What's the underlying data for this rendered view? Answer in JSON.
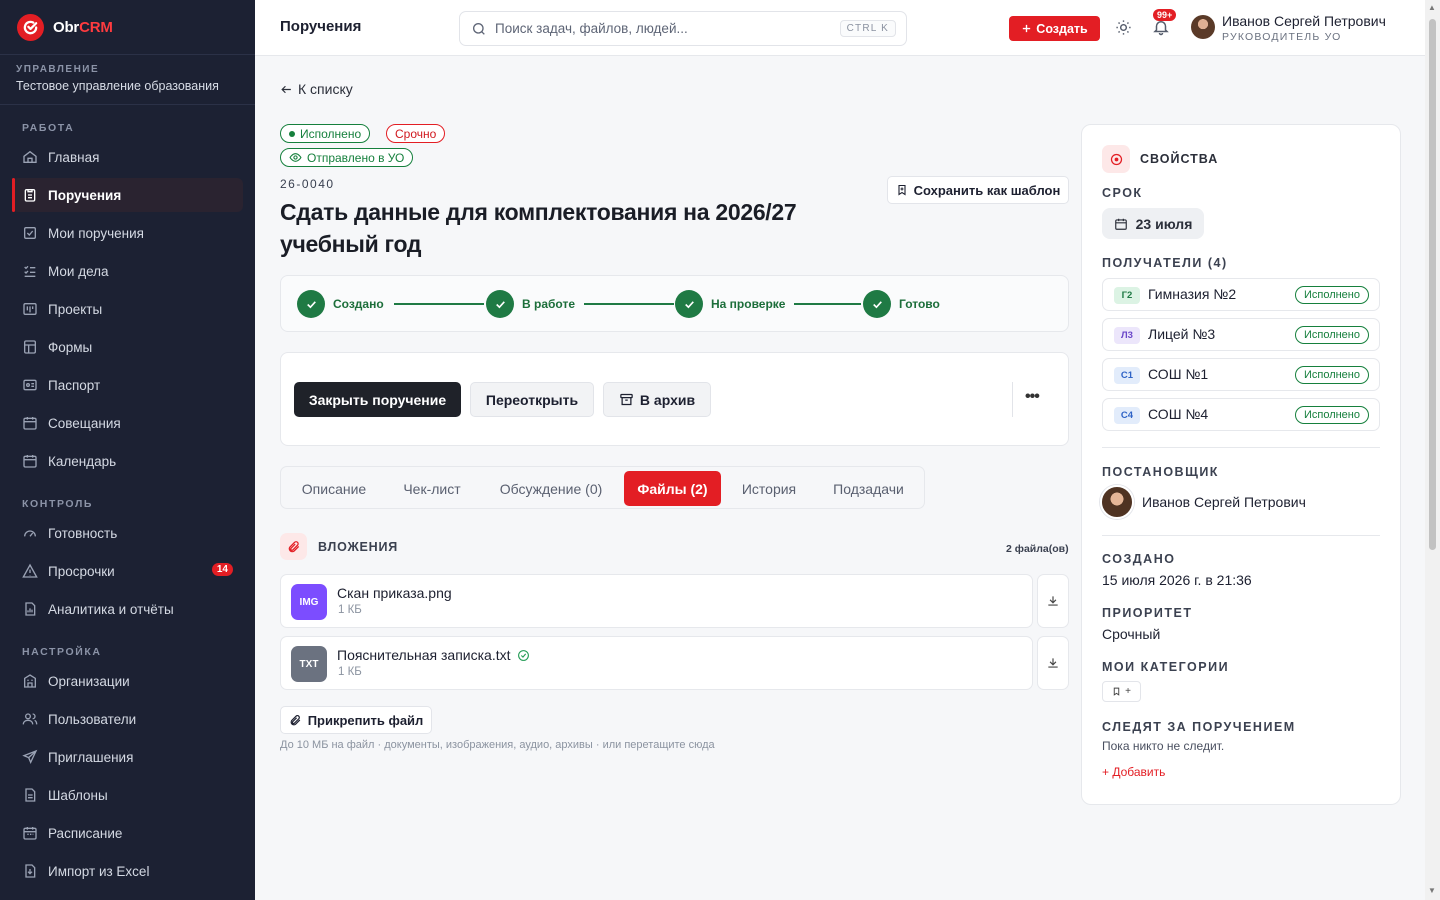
{
  "app": {
    "logo_main": "Obr",
    "logo_accent": "CRM"
  },
  "org": {
    "caption": "УПРАВЛЕНИЕ",
    "name": "Тестовое управление образования"
  },
  "sidebar": {
    "sections": [
      "РАБОТА",
      "КОНТРОЛЬ",
      "НАСТРОЙКА"
    ],
    "items": [
      {
        "label": "Главная",
        "icon": "home-icon"
      },
      {
        "label": "Поручения",
        "icon": "clipboard-icon",
        "active": true
      },
      {
        "label": "Мои поручения",
        "icon": "check-square-icon"
      },
      {
        "label": "Мои дела",
        "icon": "list-check-icon"
      },
      {
        "label": "Проекты",
        "icon": "kanban-icon"
      },
      {
        "label": "Формы",
        "icon": "form-icon"
      },
      {
        "label": "Паспорт",
        "icon": "id-card-icon"
      },
      {
        "label": "Совещания",
        "icon": "calendar-icon"
      },
      {
        "label": "Календарь",
        "icon": "calendar-icon"
      },
      {
        "label": "Готовность",
        "icon": "gauge-icon"
      },
      {
        "label": "Просрочки",
        "icon": "warning-icon",
        "badge": "14"
      },
      {
        "label": "Аналитика и отчёты",
        "icon": "report-icon"
      },
      {
        "label": "Организации",
        "icon": "building-icon"
      },
      {
        "label": "Пользователи",
        "icon": "users-icon"
      },
      {
        "label": "Приглашения",
        "icon": "send-icon"
      },
      {
        "label": "Шаблоны",
        "icon": "document-icon"
      },
      {
        "label": "Расписание",
        "icon": "schedule-icon"
      },
      {
        "label": "Импорт из Excel",
        "icon": "import-icon"
      }
    ]
  },
  "topbar": {
    "title": "Поручения",
    "search_placeholder": "Поиск задач, файлов, людей...",
    "search_shortcut": "CTRL K",
    "create_label": "Создать",
    "notif_count": "99+",
    "user_name": "Иванов Сергей Петрович",
    "user_role": "РУКОВОДИТЕЛЬ УО"
  },
  "task": {
    "back_label": "К списку",
    "status_done": "Исполнено",
    "priority_tag": "Срочно",
    "sent_tag": "Отправлено в УО",
    "code": "26-0040",
    "save_template": "Сохранить как шаблон",
    "title_line1": "Сдать данные для комплектования на 2026/27",
    "title_line2": "учебный год",
    "steps": [
      "Создано",
      "В работе",
      "На проверке",
      "Готово"
    ],
    "actions": {
      "close": "Закрыть поручение",
      "reopen": "Переоткрыть",
      "archive": "В архив"
    }
  },
  "tabs": [
    "Описание",
    "Чек-лист",
    "Обсуждение (0)",
    "Файлы (2)",
    "История",
    "Подзадачи"
  ],
  "attachments": {
    "title": "ВЛОЖЕНИЯ",
    "count": "2 файла(ов)",
    "files": [
      {
        "type": "IMG",
        "name": "Скан приказа.png",
        "size": "1 КБ",
        "color": "#7c4dff"
      },
      {
        "type": "TXT",
        "name": "Пояснительная записка.txt",
        "size": "1 КБ",
        "color": "#6b7280",
        "verified": true
      }
    ],
    "attach_label": "Прикрепить файл",
    "hint": "До 10 МБ на файл · документы, изображения, аудио, архивы · или перетащите сюда"
  },
  "properties": {
    "title": "СВОЙСТВА",
    "due_label": "СРОК",
    "due_value": "23 июля",
    "recipients_label": "ПОЛУЧАТЕЛИ (4)",
    "recipients": [
      {
        "abbr": "Г2",
        "name": "Гимназия №2",
        "status": "Исполнено",
        "bg": "#dcf3e4",
        "fg": "#1f7a44"
      },
      {
        "abbr": "Л3",
        "name": "Лицей №3",
        "status": "Исполнено",
        "bg": "#ece6fb",
        "fg": "#6b47c9"
      },
      {
        "abbr": "С1",
        "name": "СОШ №1",
        "status": "Исполнено",
        "bg": "#e2ecfb",
        "fg": "#2f63c6"
      },
      {
        "abbr": "С4",
        "name": "СОШ №4",
        "status": "Исполнено",
        "bg": "#e2ecfb",
        "fg": "#2f63c6"
      }
    ],
    "author_label": "ПОСТАНОВЩИК",
    "author_name": "Иванов Сергей Петрович",
    "created_label": "СОЗДАНО",
    "created_value": "15 июля 2026 г. в 21:36",
    "priority_label": "ПРИОРИТЕТ",
    "priority_value": "Срочный",
    "categories_label": "МОИ КАТЕГОРИИ",
    "followers_label": "СЛЕДЯТ ЗА ПОРУЧЕНИЕМ",
    "followers_empty": "Пока никто не следит.",
    "add_follower": "+ Добавить"
  },
  "colors": {
    "accent": "#e31e24",
    "success": "#1f7a44",
    "sidebar": "#1c2133"
  }
}
